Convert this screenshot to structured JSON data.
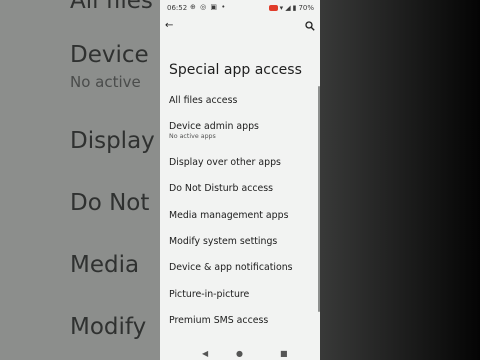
{
  "background": {
    "left_lines": [
      "All files",
      "Device",
      "No active",
      "Display",
      "Do Not",
      "Media",
      "Modify"
    ]
  },
  "status_bar": {
    "time": "06:52",
    "battery": "70%"
  },
  "header": {
    "title": "Special app access"
  },
  "items": [
    {
      "label": "All files access"
    },
    {
      "label": "Device admin apps",
      "summary": "No active apps"
    },
    {
      "label": "Display over other apps"
    },
    {
      "label": "Do Not Disturb access"
    },
    {
      "label": "Media management apps"
    },
    {
      "label": "Modify system settings"
    },
    {
      "label": "Device & app notifications"
    },
    {
      "label": "Picture-in-picture"
    },
    {
      "label": "Premium SMS access"
    }
  ],
  "colors": {
    "background": "#f2f3f2",
    "text": "#202020",
    "recording": "#e03c2b"
  }
}
